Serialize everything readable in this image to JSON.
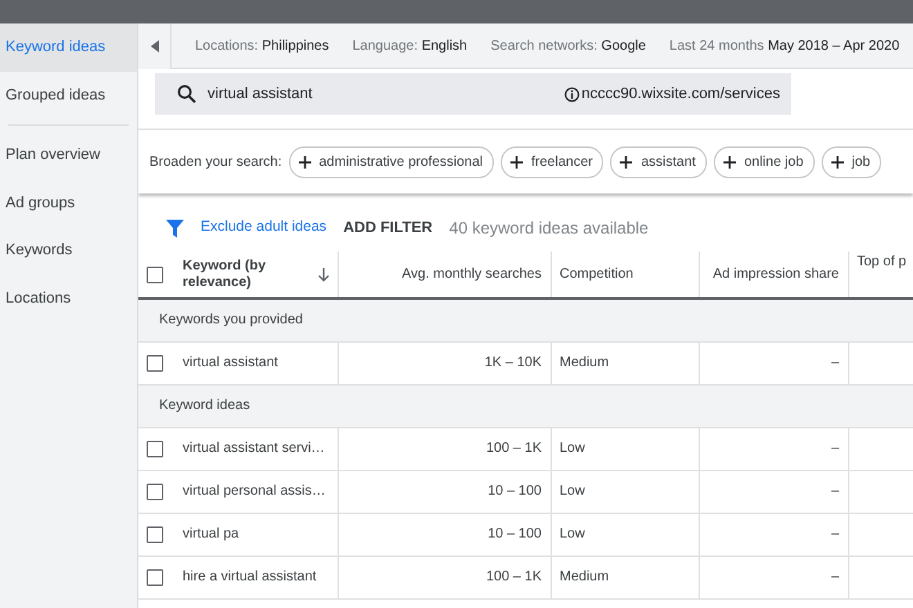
{
  "sidebar": {
    "items": [
      {
        "label": "Keyword ideas",
        "selected": true
      },
      {
        "label": "Grouped ideas",
        "selected": false
      },
      {
        "kind": "divider"
      },
      {
        "label": "Plan overview",
        "selected": false
      },
      {
        "label": "Ad groups",
        "selected": false
      },
      {
        "label": "Keywords",
        "selected": false
      },
      {
        "label": "Locations",
        "selected": false
      }
    ]
  },
  "settings_bar": [
    {
      "name": "Locations:",
      "value": "Philippines"
    },
    {
      "name": "Language:",
      "value": "English"
    },
    {
      "name": "Search networks:",
      "value": "Google"
    },
    {
      "name": "Last 24 months",
      "value": "May 2018 – Apr 2020"
    }
  ],
  "search": {
    "query": "virtual assistant",
    "site": "ncccc90.wixsite.com/services"
  },
  "broaden": {
    "label": "Broaden your search:",
    "chips": [
      "administrative professional",
      "freelancer",
      "assistant",
      "online job",
      "job"
    ]
  },
  "filter_bar": {
    "exclude_link": "Exclude adult ideas",
    "add_filter": "ADD FILTER",
    "count": "40 keyword ideas available"
  },
  "table": {
    "select_all_checked": false,
    "columns": [
      "Keyword (by relevance)",
      "Avg. monthly searches",
      "Competition",
      "Ad impression share",
      "Top of p"
    ],
    "groups": [
      {
        "title": "Keywords you provided",
        "rows": [
          {
            "keyword": "virtual assistant",
            "searches": "1K – 10K",
            "competition": "Medium",
            "impression_share": "–",
            "checked": false
          }
        ]
      },
      {
        "title": "Keyword ideas",
        "rows": [
          {
            "keyword": "virtual assistant servi…",
            "searches": "100 – 1K",
            "competition": "Low",
            "impression_share": "–",
            "checked": false
          },
          {
            "keyword": "virtual personal assis…",
            "searches": "10 – 100",
            "competition": "Low",
            "impression_share": "–",
            "checked": false
          },
          {
            "keyword": "virtual pa",
            "searches": "10 – 100",
            "competition": "Low",
            "impression_share": "–",
            "checked": false
          },
          {
            "keyword": "hire a virtual assistant",
            "searches": "100 – 1K",
            "competition": "Medium",
            "impression_share": "–",
            "checked": false
          }
        ]
      }
    ]
  }
}
